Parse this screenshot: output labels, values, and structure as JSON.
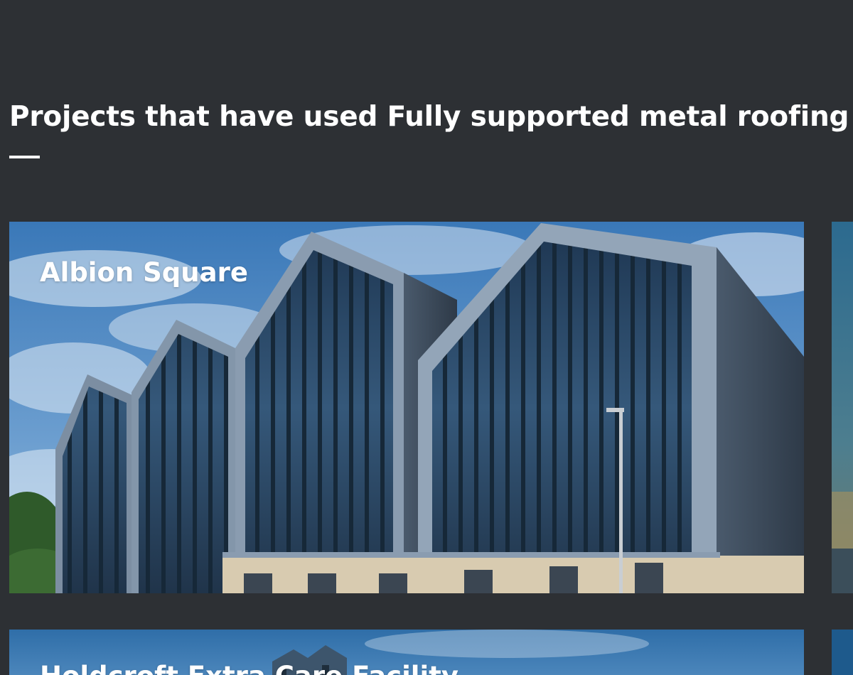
{
  "section": {
    "title": "Projects that have used Fully supported metal roofing & cladding"
  },
  "projects": [
    {
      "label": "Albion Square"
    },
    {
      "label": ""
    },
    {
      "label": "Holdcroft Extra Care Facility"
    },
    {
      "label": ""
    }
  ],
  "colors": {
    "background": "#2d3034",
    "text": "#ffffff"
  }
}
